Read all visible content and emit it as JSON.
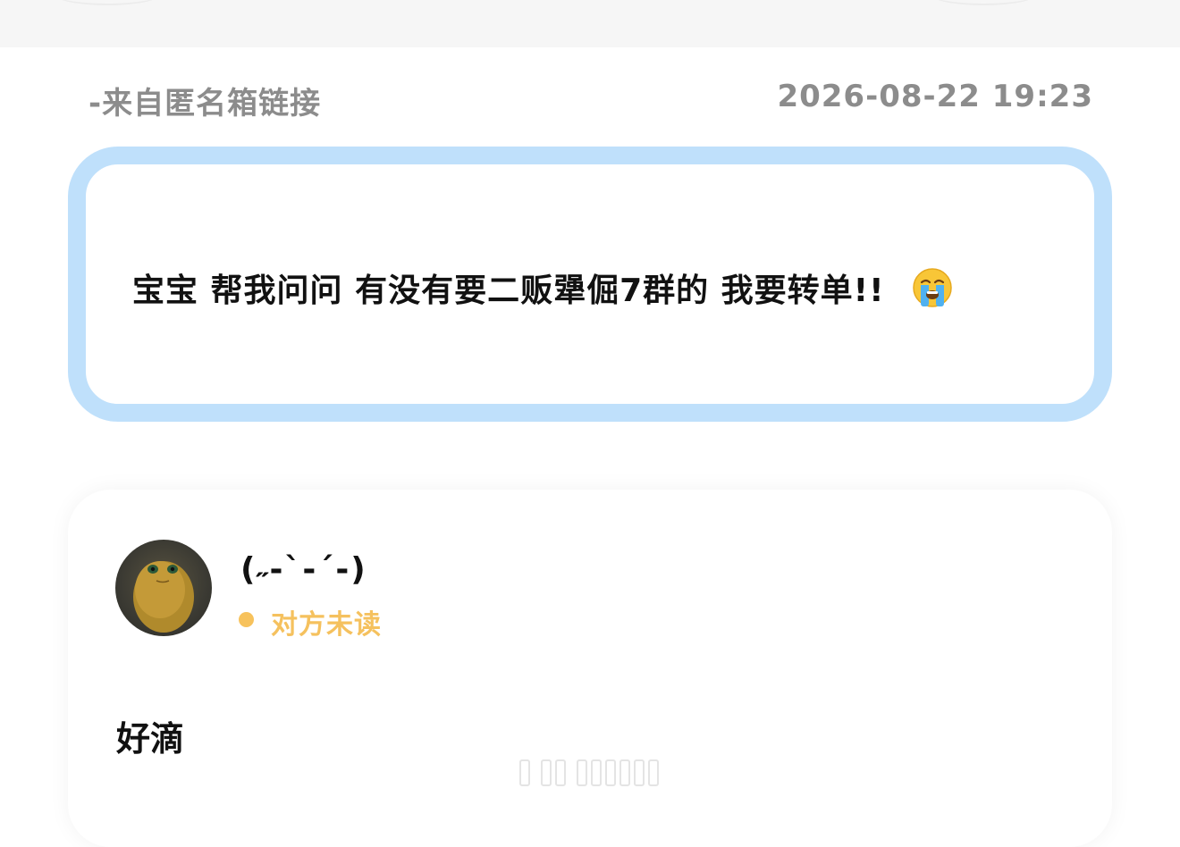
{
  "header": {
    "source_label": "-来自匿名箱链接",
    "timestamp": "2026-08-22 19:23"
  },
  "question": {
    "text": "宝宝 帮我问问 有没有要二贩犟倔7群的 我要转单!!",
    "emoji": "loudly-crying-face"
  },
  "reply": {
    "nickname": "(˶‐`‐´‐)",
    "status": "对方未读",
    "text": "好滴"
  },
  "colors": {
    "card_border": "#bfe0fb",
    "status": "#f5c15e",
    "meta_text": "#8c8c8c"
  }
}
